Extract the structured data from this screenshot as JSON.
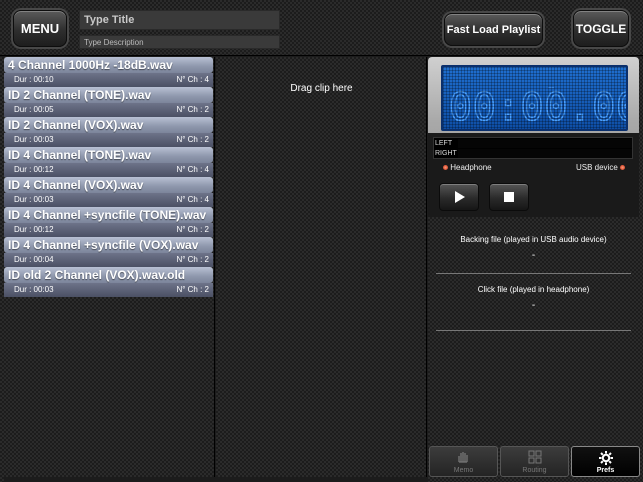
{
  "header": {
    "menu_label": "MENU",
    "title_placeholder": "Type Title",
    "description_placeholder": "Type Description",
    "fast_load_label": "Fast Load Playlist",
    "toggle_label": "TOGGLE"
  },
  "clips": [
    {
      "name": "4 Channel 1000Hz -18dB.wav",
      "dur": "Dur : 00:10",
      "ch": "N° Ch : 4"
    },
    {
      "name": "ID 2 Channel (TONE).wav",
      "dur": "Dur : 00:05",
      "ch": "N° Ch : 2"
    },
    {
      "name": "ID 2 Channel (VOX).wav",
      "dur": "Dur : 00:03",
      "ch": "N° Ch : 2"
    },
    {
      "name": "ID 4 Channel (TONE).wav",
      "dur": "Dur : 00:12",
      "ch": "N° Ch : 4"
    },
    {
      "name": "ID 4 Channel (VOX).wav",
      "dur": "Dur : 00:03",
      "ch": "N° Ch : 4"
    },
    {
      "name": "ID 4 Channel +syncfile (TONE).wav",
      "dur": "Dur : 00:12",
      "ch": "N° Ch : 2"
    },
    {
      "name": "ID 4 Channel +syncfile (VOX).wav",
      "dur": "Dur : 00:04",
      "ch": "N° Ch : 2"
    },
    {
      "name": "ID old 2 Channel (VOX).wav.old",
      "dur": "Dur : 00:03",
      "ch": "N° Ch : 2"
    }
  ],
  "drop_area": {
    "label": "Drag clip here"
  },
  "player": {
    "time": "00:00.00",
    "lcd_dash": "_",
    "meter_left": "LEFT",
    "meter_right": "RIGHT",
    "headphone_label": "Headphone",
    "usb_label": "USB device",
    "accent_lcd": "#1f6fd0"
  },
  "info": {
    "backing_title": "Backing file (played in USB audio device)",
    "backing_value": "-",
    "click_title": "Click file (played in headphone)",
    "click_value": "-"
  },
  "tabs": [
    {
      "label": "Memo",
      "icon": "hand-icon"
    },
    {
      "label": "Routing",
      "icon": "grid-icon"
    },
    {
      "label": "Prefs",
      "icon": "gear-icon",
      "active": true
    }
  ]
}
